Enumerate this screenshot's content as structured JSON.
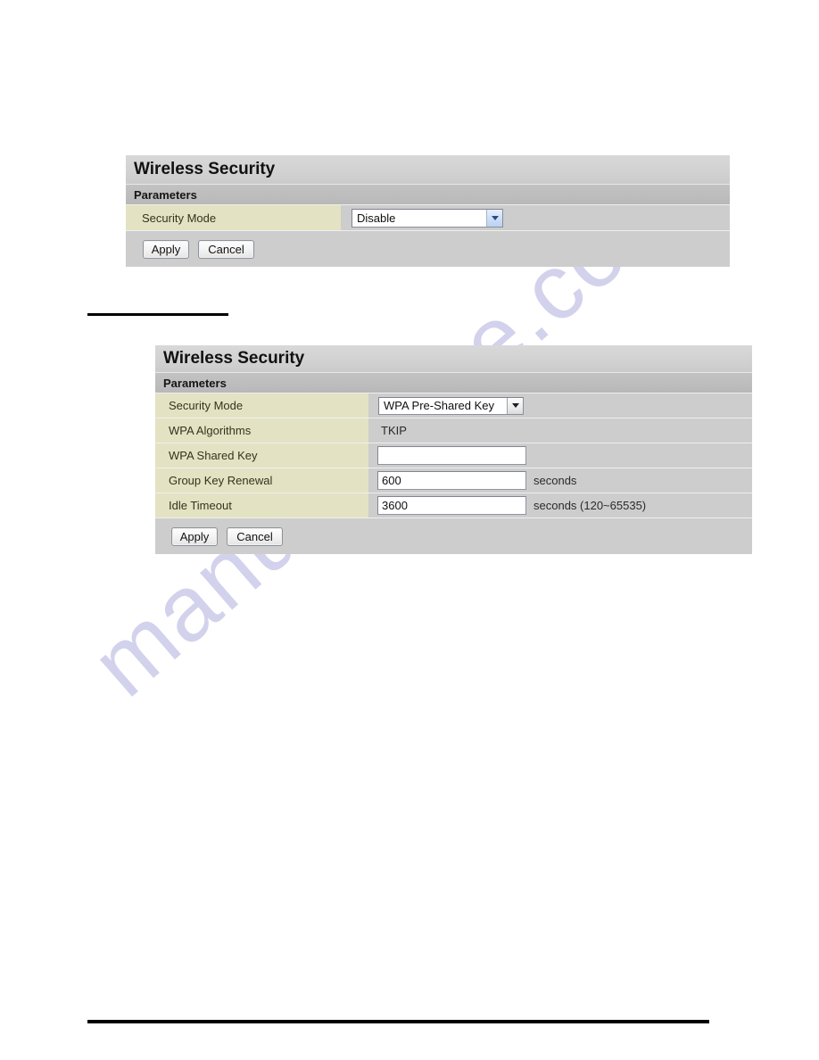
{
  "watermark": {
    "text": "manualshive.com"
  },
  "panel_disable": {
    "title": "Wireless Security",
    "subtitle": "Parameters",
    "rows": [
      {
        "label": "Security Mode",
        "type": "select",
        "value": "Disable"
      }
    ],
    "buttons": {
      "apply": "Apply",
      "cancel": "Cancel"
    }
  },
  "panel_wpa": {
    "title": "Wireless Security",
    "subtitle": "Parameters",
    "rows": [
      {
        "label": "Security Mode",
        "type": "select",
        "value": "WPA Pre-Shared Key"
      },
      {
        "label": "WPA Algorithms",
        "type": "text",
        "value": "TKIP"
      },
      {
        "label": "WPA Shared Key",
        "type": "input",
        "value": "",
        "unit": ""
      },
      {
        "label": "Group Key Renewal",
        "type": "input",
        "value": "600",
        "unit": "seconds"
      },
      {
        "label": "Idle Timeout",
        "type": "input",
        "value": "3600",
        "unit": "seconds (120~65535)"
      }
    ],
    "buttons": {
      "apply": "Apply",
      "cancel": "Cancel"
    }
  },
  "colors": {
    "label_khaki": "#e3e3c3",
    "panel_gray": "#cdcdcd",
    "title_gray": "#d4d4d4",
    "subtitle_gray": "#bdbdbd",
    "watermark": "#b9b7e2"
  }
}
